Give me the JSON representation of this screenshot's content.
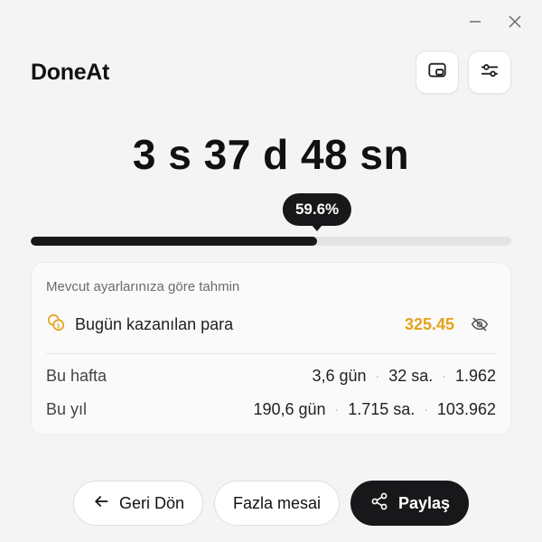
{
  "window": {
    "minimize_icon": "minimize-icon",
    "close_icon": "close-icon"
  },
  "header": {
    "app_title": "DoneAt",
    "actions": [
      {
        "icon": "picture-in-picture-icon"
      },
      {
        "icon": "sliders-icon"
      }
    ]
  },
  "timer": {
    "display": "3 s 37 d 48 sn",
    "progress_label": "59.6%",
    "progress_fraction": 0.596
  },
  "estimate": {
    "caption": "Mevcut ayarlarınıza göre tahmin",
    "earned_label": "Bugün kazanılan para",
    "earned_value": "325.45",
    "earned_color": "#e5a21a",
    "coin_icon": "coins-icon",
    "visibility_icon": "eye-off-icon",
    "rows": [
      {
        "label": "Bu hafta",
        "days": "3,6 gün",
        "hours": "32 sa.",
        "amount": "1.962"
      },
      {
        "label": "Bu yıl",
        "days": "190,6 gün",
        "hours": "1.715 sa.",
        "amount": "103.962"
      }
    ]
  },
  "footer": {
    "back_label": "Geri Dön",
    "overtime_label": "Fazla mesai",
    "share_label": "Paylaş",
    "back_icon": "arrow-left-icon",
    "share_icon": "share-icon"
  },
  "colors": {
    "accent_dark": "#18181b",
    "earned": "#e5a21a"
  }
}
